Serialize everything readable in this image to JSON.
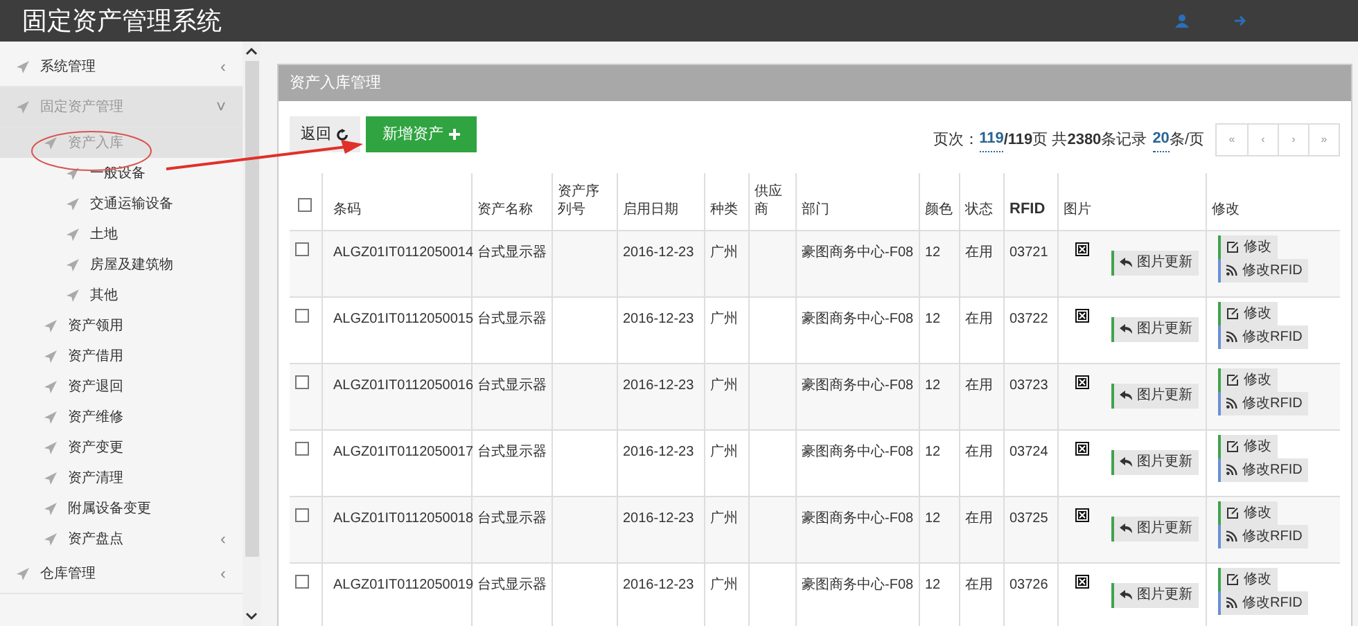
{
  "app_title": "固定资产管理系统",
  "sidebar": {
    "items": [
      {
        "label": "系统管理",
        "chevron": "‹",
        "expanded": false,
        "selected": false
      },
      {
        "label": "固定资产管理",
        "chevron": "˅",
        "expanded": true,
        "selected": false,
        "children": [
          {
            "label": "资产入库",
            "expanded": true,
            "selected": true,
            "children": [
              {
                "label": "一般设备",
                "selected": false
              },
              {
                "label": "交通运输设备",
                "selected": false
              },
              {
                "label": "土地",
                "selected": false
              },
              {
                "label": "房屋及建筑物",
                "selected": false
              },
              {
                "label": "其他",
                "selected": false
              }
            ]
          },
          {
            "label": "资产领用",
            "selected": false
          },
          {
            "label": "资产借用",
            "selected": false
          },
          {
            "label": "资产退回",
            "selected": false
          },
          {
            "label": "资产维修",
            "selected": false
          },
          {
            "label": "资产变更",
            "selected": false
          },
          {
            "label": "资产清理",
            "selected": false
          },
          {
            "label": "附属设备变更",
            "selected": false
          },
          {
            "label": "资产盘点",
            "chevron": "‹",
            "selected": false
          }
        ]
      },
      {
        "label": "仓库管理",
        "chevron": "‹",
        "expanded": false,
        "selected": false
      }
    ]
  },
  "panel": {
    "title": "资产入库管理",
    "back_button": "返回",
    "add_button": "新增资产",
    "page_info": {
      "prefix": "页次：",
      "current": "119",
      "totals": "**/119**页 共**2380**条记录",
      "per_page": "20",
      "suffix": "条/页"
    },
    "pager": [
      "«",
      "‹",
      "›",
      "»"
    ],
    "table": {
      "select_all": {
        "checked": false
      },
      "columns": [
        "条码",
        "资产名称",
        "资产序列号",
        "启用日期",
        "种类",
        "供应商",
        "部门",
        "颜色",
        "状态",
        "RFID",
        "图片",
        "修改"
      ],
      "rows": [
        {
          "checked": false,
          "cells": [
            "ALGZ01IT0112050014",
            "台式显示器",
            "",
            "2016-12-23",
            "广州",
            "",
            "豪图商务中心-F08",
            "12",
            "在用",
            "03721"
          ],
          "image_button": "图片更新",
          "edit_button": "修改",
          "rfid_button": "修改RFID"
        },
        {
          "checked": false,
          "cells": [
            "ALGZ01IT0112050015",
            "台式显示器",
            "",
            "2016-12-23",
            "广州",
            "",
            "豪图商务中心-F08",
            "12",
            "在用",
            "03722"
          ],
          "image_button": "图片更新",
          "edit_button": "修改",
          "rfid_button": "修改RFID"
        },
        {
          "checked": false,
          "cells": [
            "ALGZ01IT0112050016",
            "台式显示器",
            "",
            "2016-12-23",
            "广州",
            "",
            "豪图商务中心-F08",
            "12",
            "在用",
            "03723"
          ],
          "image_button": "图片更新",
          "edit_button": "修改",
          "rfid_button": "修改RFID"
        },
        {
          "checked": false,
          "cells": [
            "ALGZ01IT0112050017",
            "台式显示器",
            "",
            "2016-12-23",
            "广州",
            "",
            "豪图商务中心-F08",
            "12",
            "在用",
            "03724"
          ],
          "image_button": "图片更新",
          "edit_button": "修改",
          "rfid_button": "修改RFID"
        },
        {
          "checked": false,
          "cells": [
            "ALGZ01IT0112050018",
            "台式显示器",
            "",
            "2016-12-23",
            "广州",
            "",
            "豪图商务中心-F08",
            "12",
            "在用",
            "03725"
          ],
          "image_button": "图片更新",
          "edit_button": "修改",
          "rfid_button": "修改RFID"
        },
        {
          "checked": false,
          "cells": [
            "ALGZ01IT0112050019",
            "台式显示器",
            "",
            "2016-12-23",
            "广州",
            "",
            "豪图商务中心-F08",
            "12",
            "在用",
            "03726"
          ],
          "image_button": "图片更新",
          "edit_button": "修改",
          "rfid_button": "修改RFID"
        }
      ]
    }
  }
}
